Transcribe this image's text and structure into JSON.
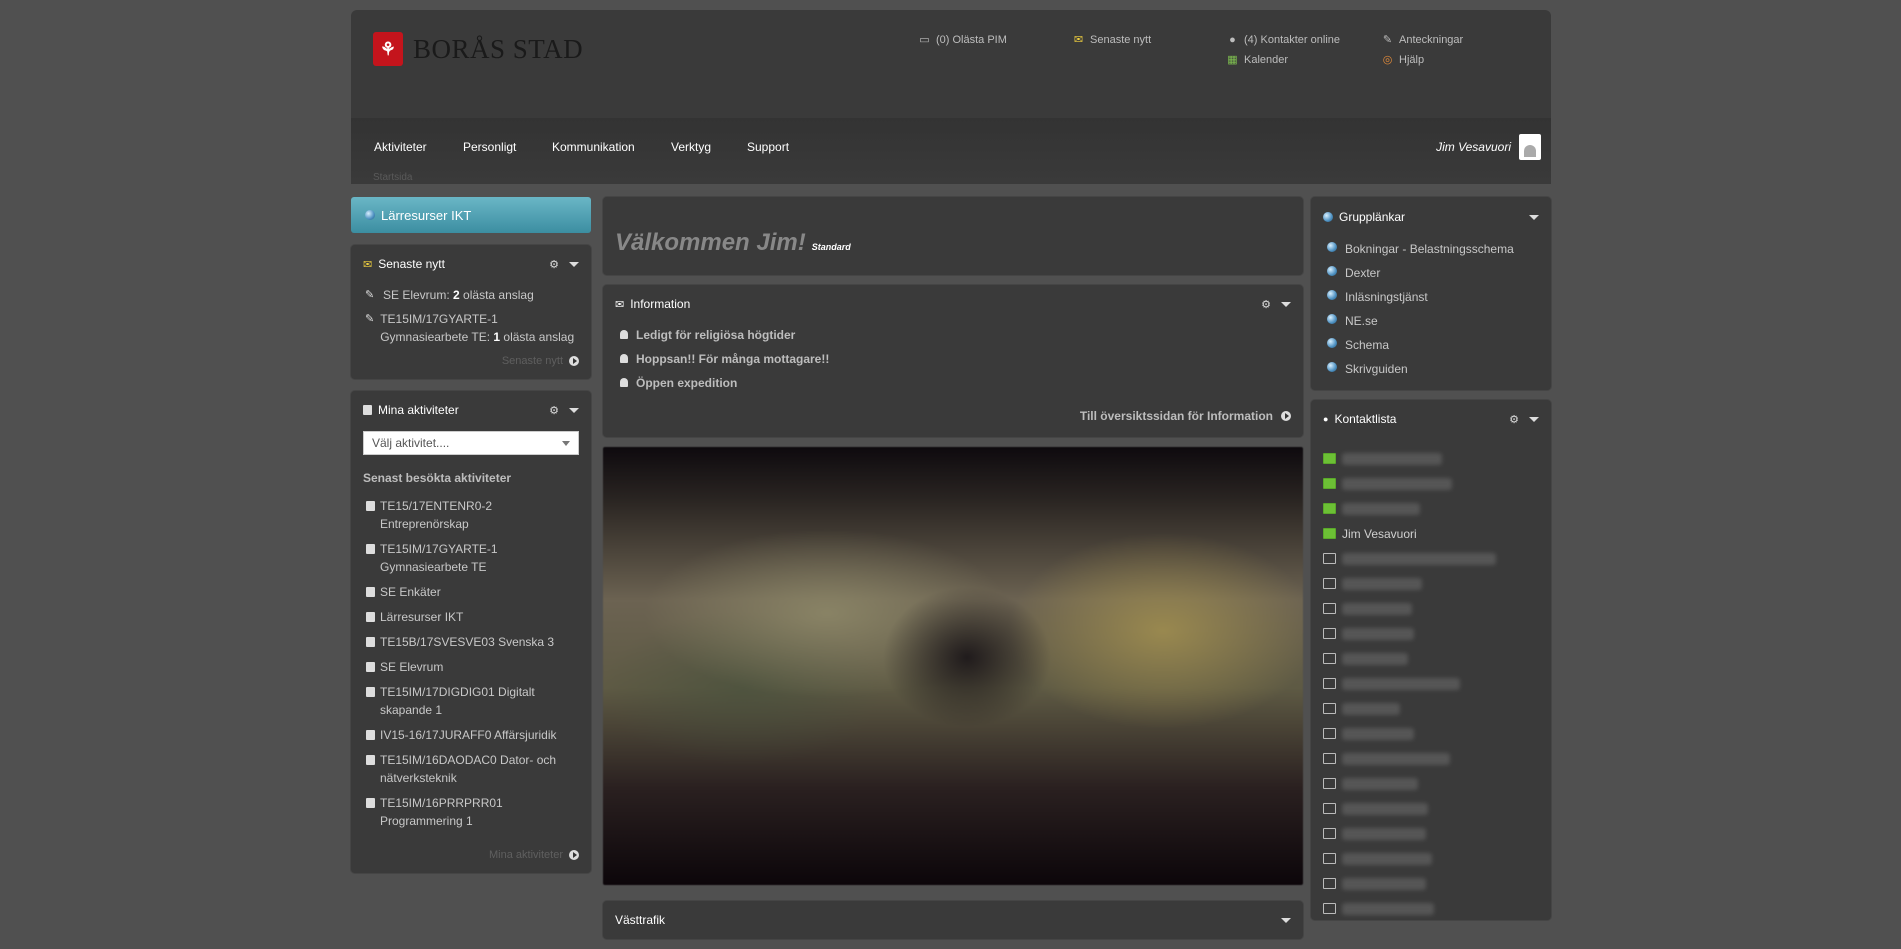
{
  "header": {
    "logo_text": "BORÅS STAD",
    "top_links": [
      {
        "label": "(0) Olästa PIM",
        "icon": "chat-icon"
      },
      {
        "label": "Senaste nytt",
        "icon": "news-icon"
      },
      {
        "label": "(4) Kontakter online",
        "icon": "person-icon"
      },
      {
        "label": "Kalender",
        "icon": "calendar-icon"
      },
      {
        "label": "Anteckningar",
        "icon": "notes-icon"
      },
      {
        "label": "Hjälp",
        "icon": "lifebuoy-icon"
      }
    ],
    "nav": [
      "Aktiviteter",
      "Personligt",
      "Kommunikation",
      "Verktyg",
      "Support"
    ],
    "breadcrumb": "Startsida",
    "user_name": "Jim Vesavuori"
  },
  "left": {
    "larresurser_label": "Lärresurser IKT",
    "news": {
      "title": "Senaste nytt",
      "items": [
        {
          "pre": "SE Elevrum: ",
          "count": "2",
          "post": " olästa anslag"
        },
        {
          "pre": "TE15IM/17GYARTE-1 Gymnasiearbete TE: ",
          "count": "1",
          "post": " olästa anslag"
        }
      ],
      "more": "Senaste nytt"
    },
    "activities": {
      "title": "Mina aktiviteter",
      "select_placeholder": "Välj aktivitet....",
      "subheading": "Senast besökta aktiviteter",
      "items": [
        "TE15/17ENTENR0-2 Entreprenörskap",
        "TE15IM/17GYARTE-1 Gymnasiearbete TE",
        "SE Enkäter",
        "Lärresurser IKT",
        "TE15B/17SVESVE03 Svenska 3",
        "SE Elevrum",
        "TE15IM/17DIGDIG01 Digitalt skapande 1",
        "IV15-16/17JURAFF0 Affärsjuridik",
        "TE15IM/16DAODAC0 Dator- och nätverksteknik",
        "TE15IM/16PRRPRR01 Programmering 1"
      ],
      "more": "Mina aktiviteter"
    }
  },
  "center": {
    "welcome": "Välkommen Jim!",
    "welcome_tag": "Standard",
    "info": {
      "title": "Information",
      "items": [
        "Ledigt för religiösa högtider",
        "Hoppsan!! För många mottagare!!",
        "Öppen expedition"
      ],
      "more": "Till översiktssidan för Information"
    },
    "vasttrafik_title": "Västtrafik"
  },
  "right": {
    "links": {
      "title": "Grupplänkar",
      "items": [
        "Bokningar - Belastningsschema",
        "Dexter",
        "Inläsningstjänst",
        "NE.se",
        "Schema",
        "Skrivguiden"
      ]
    },
    "contacts": {
      "title": "Kontaktlista",
      "visible_name": "Jim Vesavuori"
    }
  },
  "colors": {
    "background": "#505050",
    "panel": "#3a3a3a",
    "accent_button": "#4fa3b5",
    "online": "#6cc035"
  }
}
